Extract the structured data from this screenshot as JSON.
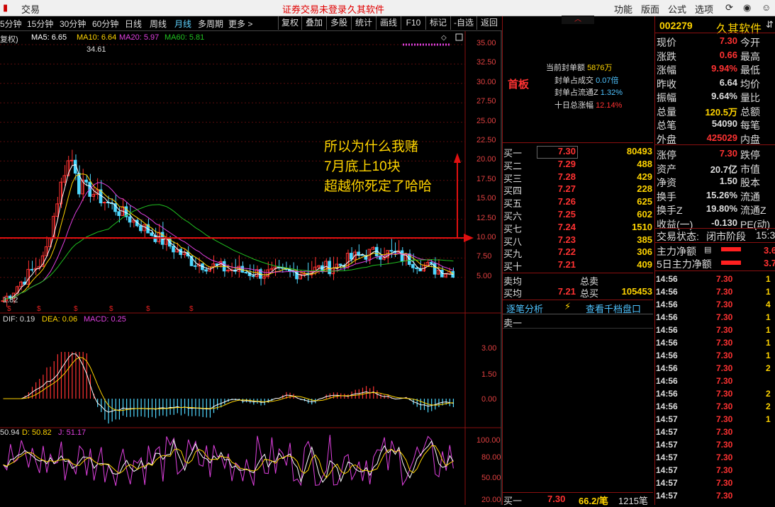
{
  "topbar": {
    "trade": "交易",
    "warning": "证券交易未登录",
    "app": "久其软件",
    "menu": [
      "功能",
      "版面",
      "公式",
      "选项"
    ]
  },
  "period_tabs": [
    "5分钟",
    "15分钟",
    "30分钟",
    "60分钟",
    "日线",
    "周线",
    "月线",
    "多周期",
    "更多 >"
  ],
  "tool_buttons": [
    "复权",
    "叠加",
    "多股",
    "统计",
    "画线",
    "F10",
    "标记",
    "-自选",
    "返回"
  ],
  "chart": {
    "fq_label": "复权)",
    "ma": [
      {
        "label": "MA5: 6.65",
        "color": "#ffffff"
      },
      {
        "label": "MA10: 6.64",
        "color": "#ffd400"
      },
      {
        "label": "MA20: 5.97",
        "color": "#e040e0"
      },
      {
        "label": "MA60: 5.81",
        "color": "#20c020"
      }
    ],
    "high_label": "34.61",
    "low_label": "1.82",
    "price_axis": [
      "35.00",
      "32.50",
      "30.00",
      "27.50",
      "25.00",
      "22.50",
      "20.00",
      "17.50",
      "15.00",
      "12.50",
      "10.00",
      "7.50",
      "5.00"
    ],
    "annotation": [
      "所以为什么我赌",
      "7月底上10块",
      "超越你死定了哈哈"
    ],
    "macd_label": {
      "dif": "DIF: 0.19",
      "dea": "DEA: 0.06",
      "macd": "MACD: 0.25"
    },
    "macd_axis": [
      "3.00",
      "1.50",
      "0.00"
    ],
    "kdj_label": {
      "k": "50.94",
      "d": "D: 50.82",
      "j": "J: 51.17"
    },
    "kdj_axis": [
      "100.00",
      "80.00",
      "50.00",
      "20.00"
    ]
  },
  "limit_panel": {
    "title": "首板",
    "rows": [
      {
        "label": "当前封单额",
        "value": "5876万"
      },
      {
        "label": "封单占成交",
        "value": "0.07倍"
      },
      {
        "label": "封单占流通Z",
        "value": "1.32%"
      },
      {
        "label": "十日总涨幅",
        "value": "12.14%"
      }
    ]
  },
  "order_book": {
    "bids": [
      {
        "label": "买一",
        "price": "7.30",
        "vol": "80493"
      },
      {
        "label": "买二",
        "price": "7.29",
        "vol": "488"
      },
      {
        "label": "买三",
        "price": "7.28",
        "vol": "429"
      },
      {
        "label": "买四",
        "price": "7.27",
        "vol": "228"
      },
      {
        "label": "买五",
        "price": "7.26",
        "vol": "625"
      },
      {
        "label": "买六",
        "price": "7.25",
        "vol": "602"
      },
      {
        "label": "买七",
        "price": "7.24",
        "vol": "1510"
      },
      {
        "label": "买八",
        "price": "7.23",
        "vol": "385"
      },
      {
        "label": "买九",
        "price": "7.22",
        "vol": "306"
      },
      {
        "label": "买十",
        "price": "7.21",
        "vol": "409"
      }
    ],
    "sell_avg_label": "卖均",
    "sell_total_label": "总卖",
    "buy_avg_label": "买均",
    "buy_avg": "7.21",
    "buy_total_label": "总买",
    "buy_total": "105453",
    "tab1": "逐笔分析",
    "tab2": "查看千档盘口",
    "sell_one": "卖一",
    "bottom_row": {
      "label": "买一",
      "price": "7.30",
      "vol": "66.2/笔",
      "count": "1215笔"
    }
  },
  "quote": {
    "code": "002279",
    "name": "久其软件",
    "rows": [
      {
        "l": "现价",
        "v": "7.30",
        "r": "今开",
        "c": "red"
      },
      {
        "l": "涨跌",
        "v": "0.66",
        "r": "最高",
        "c": "red"
      },
      {
        "l": "涨幅",
        "v": "9.94%",
        "r": "最低",
        "c": "red"
      },
      {
        "l": "昨收",
        "v": "6.64",
        "r": "均价",
        "c": "white"
      },
      {
        "l": "振幅",
        "v": "9.64%",
        "r": "量比",
        "c": "white"
      },
      {
        "l": "总量",
        "v": "120.5万",
        "r": "总额",
        "c": "yellow"
      },
      {
        "l": "总笔",
        "v": "54090",
        "r": "每笔",
        "c": "white"
      },
      {
        "l": "外盘",
        "v": "425029",
        "r": "内盘",
        "c": "red"
      },
      {
        "l": "涨停",
        "v": "7.30",
        "r": "跌停",
        "c": "red"
      },
      {
        "l": "资产",
        "v": "20.7亿",
        "r": "市值",
        "c": "white"
      },
      {
        "l": "净资",
        "v": "1.50",
        "r": "股本",
        "c": "white"
      },
      {
        "l": "换手",
        "v": "15.26%",
        "r": "流通",
        "c": "white"
      },
      {
        "l": "换手Z",
        "v": "19.80%",
        "r": "流通Z",
        "c": "white"
      },
      {
        "l": "收益(一)",
        "v": "-0.130",
        "r": "PE(动)",
        "c": "white"
      }
    ],
    "status_label": "交易状态:",
    "status": "闭市阶段",
    "status_time": "15:3",
    "net_main": "主力净额",
    "net_main_val": "3.6",
    "net_5d": "5日主力净额",
    "net_5d_val": "3.7"
  },
  "ticks": [
    {
      "t": "14:56",
      "p": "7.30",
      "v": "1"
    },
    {
      "t": "14:56",
      "p": "7.30",
      "v": "1"
    },
    {
      "t": "14:56",
      "p": "7.30",
      "v": "4"
    },
    {
      "t": "14:56",
      "p": "7.30",
      "v": "1"
    },
    {
      "t": "14:56",
      "p": "7.30",
      "v": "1"
    },
    {
      "t": "14:56",
      "p": "7.30",
      "v": "1"
    },
    {
      "t": "14:56",
      "p": "7.30",
      "v": "1"
    },
    {
      "t": "14:56",
      "p": "7.30",
      "v": "2"
    },
    {
      "t": "14:56",
      "p": "7.30",
      "v": ""
    },
    {
      "t": "14:56",
      "p": "7.30",
      "v": "2"
    },
    {
      "t": "14:56",
      "p": "7.30",
      "v": "2"
    },
    {
      "t": "14:57",
      "p": "7.30",
      "v": "1"
    },
    {
      "t": "14:57",
      "p": "7.30",
      "v": ""
    },
    {
      "t": "14:57",
      "p": "7.30",
      "v": ""
    },
    {
      "t": "14:57",
      "p": "7.30",
      "v": ""
    },
    {
      "t": "14:57",
      "p": "7.30",
      "v": ""
    },
    {
      "t": "14:57",
      "p": "7.30",
      "v": ""
    },
    {
      "t": "14:57",
      "p": "7.30",
      "v": ""
    }
  ]
}
